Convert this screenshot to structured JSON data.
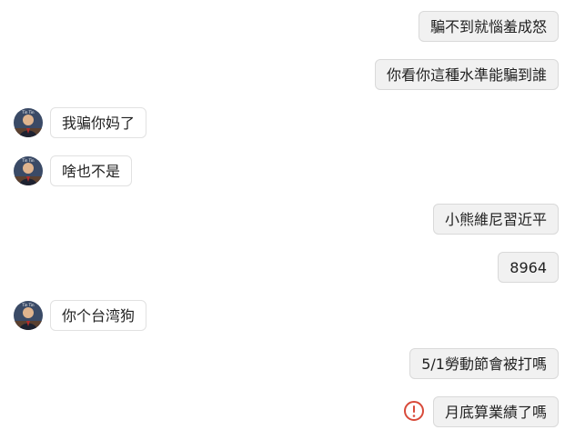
{
  "messages": [
    {
      "direction": "outgoing",
      "text": "騙不到就惱羞成怒"
    },
    {
      "direction": "outgoing",
      "text": "你看你這種水準能騙到誰"
    },
    {
      "direction": "incoming",
      "text": "我骗你妈了"
    },
    {
      "direction": "incoming",
      "text": "啥也不是"
    },
    {
      "direction": "outgoing",
      "text": "小熊維尼習近平"
    },
    {
      "direction": "outgoing",
      "text": "8964"
    },
    {
      "direction": "incoming",
      "text": "你个台湾狗"
    },
    {
      "direction": "outgoing",
      "text": "5/1勞動節會被打嗎"
    },
    {
      "direction": "outgoing",
      "text": "月底算業績了嗎",
      "status_icon": "error-exclamation-icon"
    }
  ],
  "avatar": {
    "badge_text": "Tin Tin"
  },
  "colors": {
    "error": "#d84a3a",
    "outgoing_bubble": "#f1f1f1",
    "incoming_bubble": "#ffffff"
  }
}
